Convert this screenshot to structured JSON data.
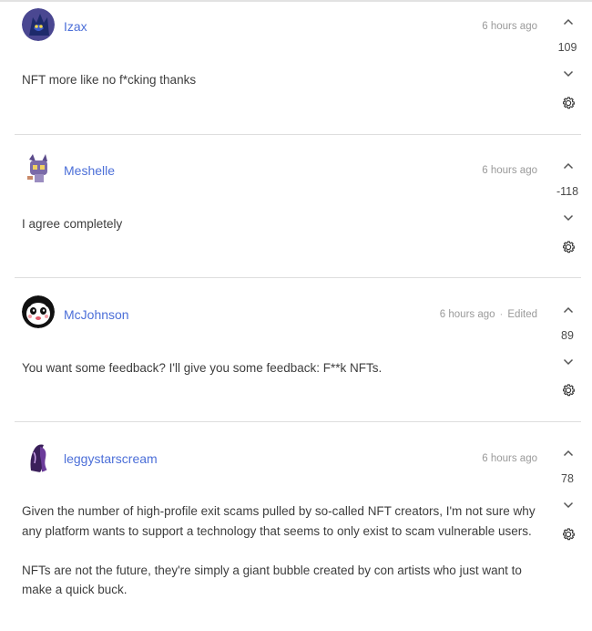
{
  "comments": [
    {
      "username": "Izax",
      "time": "6 hours ago",
      "edited": "",
      "score": "109",
      "text": [
        "NFT more like no f*cking thanks"
      ],
      "avatar_icon": "blue-creature-avatar"
    },
    {
      "username": "Meshelle",
      "time": "6 hours ago",
      "edited": "",
      "score": "-118",
      "text": [
        "I agree completely"
      ],
      "avatar_icon": "purple-cat-avatar"
    },
    {
      "username": "McJohnson",
      "time": "6 hours ago",
      "edited": "Edited",
      "score": "89",
      "text": [
        "You want some feedback? I'll give you some feedback: F**k NFTs."
      ],
      "avatar_icon": "panda-face-avatar"
    },
    {
      "username": "leggystarscream",
      "time": "6 hours ago",
      "edited": "",
      "score": "78",
      "text": [
        "Given the number of high-profile exit scams pulled by so-called NFT creators, I'm not sure why any platform wants to support a technology that seems to only exist to scam vulnerable users.",
        "NFTs are not the future, they're simply a giant bubble created by con artists who just want to make a quick buck."
      ],
      "avatar_icon": "purple-figure-avatar"
    }
  ],
  "colors": {
    "username": "#4c6fd8",
    "meta": "#9a9a9a",
    "divider": "#dedede"
  }
}
